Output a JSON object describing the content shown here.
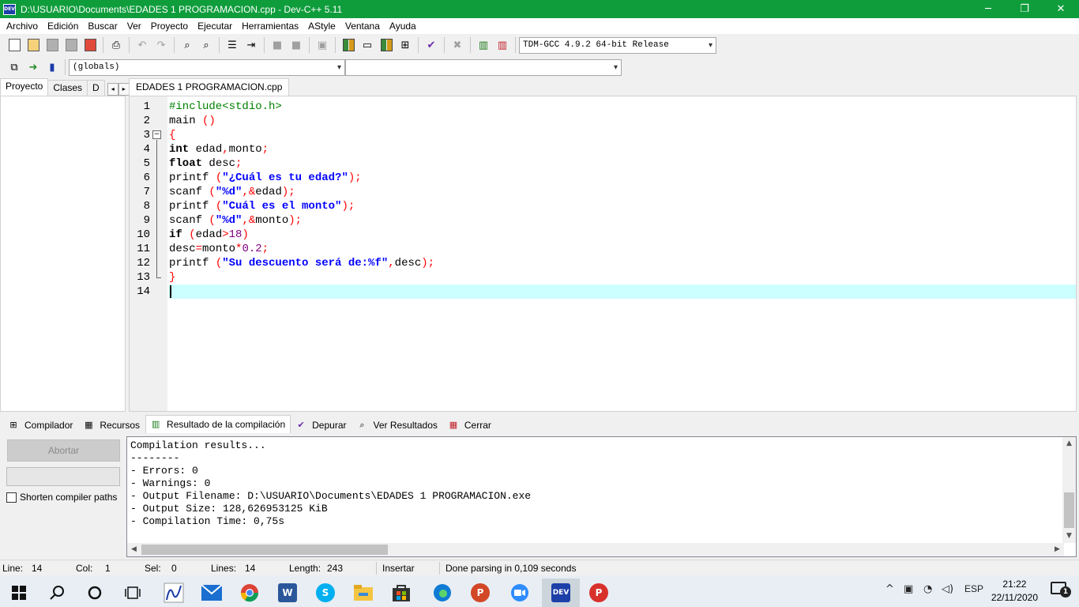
{
  "window": {
    "title": "D:\\USUARIO\\Documents\\EDADES 1 PROGRAMACION.cpp - Dev-C++ 5.11",
    "app_icon_text": "DEV",
    "controls": [
      "─",
      "❐",
      "✕"
    ]
  },
  "menu": [
    "Archivo",
    "Edición",
    "Buscar",
    "Ver",
    "Proyecto",
    "Ejecutar",
    "Herramientas",
    "AStyle",
    "Ventana",
    "Ayuda"
  ],
  "toolbar": {
    "compiler_select": "TDM-GCC 4.9.2 64-bit Release",
    "scope_select": "(globals)",
    "function_select": ""
  },
  "left_panel": {
    "tabs": [
      "Proyecto",
      "Clases",
      "D"
    ]
  },
  "editor": {
    "tab": "EDADES 1 PROGRAMACION.cpp",
    "line_numbers": [
      "1",
      "2",
      "3",
      "4",
      "5",
      "6",
      "7",
      "8",
      "9",
      "10",
      "11",
      "12",
      "13",
      "14"
    ],
    "lines": [
      [
        {
          "t": "#include<stdio.h>",
          "c": "pp"
        }
      ],
      [
        {
          "t": "main ",
          "c": "id"
        },
        {
          "t": "()",
          "c": "sym"
        }
      ],
      [
        {
          "t": "{",
          "c": "sym"
        }
      ],
      [
        {
          "t": "int",
          "c": "kw"
        },
        {
          "t": " edad",
          "c": "id"
        },
        {
          "t": ",",
          "c": "sym"
        },
        {
          "t": "monto",
          "c": "id"
        },
        {
          "t": ";",
          "c": "sym"
        }
      ],
      [
        {
          "t": "float",
          "c": "kw"
        },
        {
          "t": " desc",
          "c": "id"
        },
        {
          "t": ";",
          "c": "sym"
        }
      ],
      [
        {
          "t": "printf ",
          "c": "id"
        },
        {
          "t": "(",
          "c": "sym"
        },
        {
          "t": "\"¿Cuál es tu edad?\"",
          "c": "str"
        },
        {
          "t": ");",
          "c": "sym"
        }
      ],
      [
        {
          "t": "scanf ",
          "c": "id"
        },
        {
          "t": "(",
          "c": "sym"
        },
        {
          "t": "\"%d\"",
          "c": "str"
        },
        {
          "t": ",&",
          "c": "sym"
        },
        {
          "t": "edad",
          "c": "id"
        },
        {
          "t": ");",
          "c": "sym"
        }
      ],
      [
        {
          "t": "printf ",
          "c": "id"
        },
        {
          "t": "(",
          "c": "sym"
        },
        {
          "t": "\"Cuál es el monto\"",
          "c": "str"
        },
        {
          "t": ");",
          "c": "sym"
        }
      ],
      [
        {
          "t": "scanf ",
          "c": "id"
        },
        {
          "t": "(",
          "c": "sym"
        },
        {
          "t": "\"%d\"",
          "c": "str"
        },
        {
          "t": ",&",
          "c": "sym"
        },
        {
          "t": "monto",
          "c": "id"
        },
        {
          "t": ");",
          "c": "sym"
        }
      ],
      [
        {
          "t": "if",
          "c": "kw"
        },
        {
          "t": " ",
          "c": "id"
        },
        {
          "t": "(",
          "c": "sym"
        },
        {
          "t": "edad",
          "c": "id"
        },
        {
          "t": ">",
          "c": "sym"
        },
        {
          "t": "18",
          "c": "num"
        },
        {
          "t": ")",
          "c": "sym"
        }
      ],
      [
        {
          "t": "desc",
          "c": "id"
        },
        {
          "t": "=",
          "c": "sym"
        },
        {
          "t": "monto",
          "c": "id"
        },
        {
          "t": "*",
          "c": "sym"
        },
        {
          "t": "0.2",
          "c": "num"
        },
        {
          "t": ";",
          "c": "sym"
        }
      ],
      [
        {
          "t": "printf ",
          "c": "id"
        },
        {
          "t": "(",
          "c": "sym"
        },
        {
          "t": "\"Su descuento será de:%f\"",
          "c": "str"
        },
        {
          "t": ",",
          "c": "sym"
        },
        {
          "t": "desc",
          "c": "id"
        },
        {
          "t": ");",
          "c": "sym"
        }
      ],
      [
        {
          "t": "}",
          "c": "sym"
        }
      ],
      []
    ],
    "current_line": 14
  },
  "bottom_tabs": [
    {
      "label": "Compilador",
      "icon": "grid-icon"
    },
    {
      "label": "Recursos",
      "icon": "resources-icon"
    },
    {
      "label": "Resultado de la compilación",
      "icon": "bar-chart-icon",
      "active": true
    },
    {
      "label": "Depurar",
      "icon": "check-icon"
    },
    {
      "label": "Ver Resultados",
      "icon": "magnifier-icon"
    },
    {
      "label": "Cerrar",
      "icon": "close-window-icon"
    }
  ],
  "bottom_panel": {
    "abort_label": "Abortar",
    "shorten_label": "Shorten compiler paths",
    "output_lines": [
      "Compilation results...",
      "--------",
      "- Errors: 0",
      "- Warnings: 0",
      "- Output Filename: D:\\USUARIO\\Documents\\EDADES 1 PROGRAMACION.exe",
      "- Output Size: 128,626953125 KiB",
      "- Compilation Time: 0,75s"
    ]
  },
  "status": {
    "line_label": "Line:",
    "line_value": "14",
    "col_label": "Col:",
    "col_value": "1",
    "sel_label": "Sel:",
    "sel_value": "0",
    "lines_label": "Lines:",
    "lines_value": "14",
    "length_label": "Length:",
    "length_value": "243",
    "mode": "Insertar",
    "message": "Done parsing in 0,109 seconds"
  },
  "taskbar": {
    "lang": "ESP",
    "time": "21:22",
    "date": "22/11/2020",
    "notifications": "1",
    "colors": {
      "word": "#2b579a",
      "skype": "#00aff0",
      "powerpoint": "#d24726",
      "zoom": "#2d8cff",
      "devcpp": "#1c3fa8",
      "psiphon": "#d8312c",
      "edge": "#0f7bd4"
    }
  }
}
